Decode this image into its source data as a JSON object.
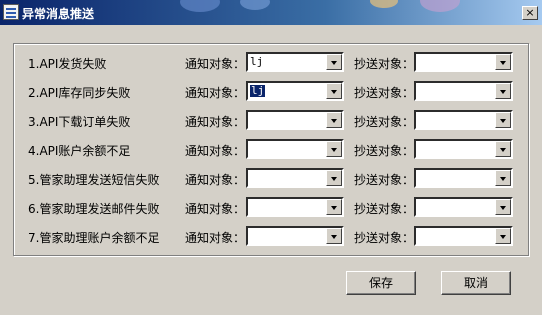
{
  "window": {
    "title": "异常消息推送",
    "close_glyph": "×"
  },
  "labels": {
    "notify": "通知对象：",
    "cc": "抄送对象："
  },
  "rows": [
    {
      "label": "1.API发货失败",
      "notify_value": "lj",
      "notify_selected": false,
      "cc_value": ""
    },
    {
      "label": "2.API库存同步失败",
      "notify_value": "lj",
      "notify_selected": true,
      "cc_value": ""
    },
    {
      "label": "3.API下载订单失败",
      "notify_value": "",
      "notify_selected": false,
      "cc_value": ""
    },
    {
      "label": "4.API账户余额不足",
      "notify_value": "",
      "notify_selected": false,
      "cc_value": ""
    },
    {
      "label": "5.管家助理发送短信失败",
      "notify_value": "",
      "notify_selected": false,
      "cc_value": ""
    },
    {
      "label": "6.管家助理发送邮件失败",
      "notify_value": "",
      "notify_selected": false,
      "cc_value": ""
    },
    {
      "label": "7.管家助理账户余额不足",
      "notify_value": "",
      "notify_selected": false,
      "cc_value": ""
    }
  ],
  "buttons": {
    "save": "保存",
    "cancel": "取消"
  },
  "colors": {
    "titlebar_start": "#0a246a",
    "titlebar_end": "#a6caf0",
    "face": "#d4d0c8",
    "selection": "#0a246a"
  },
  "icons": {
    "title": "app-window-icon",
    "close": "close-icon",
    "dropdown": "chevron-down-icon"
  }
}
